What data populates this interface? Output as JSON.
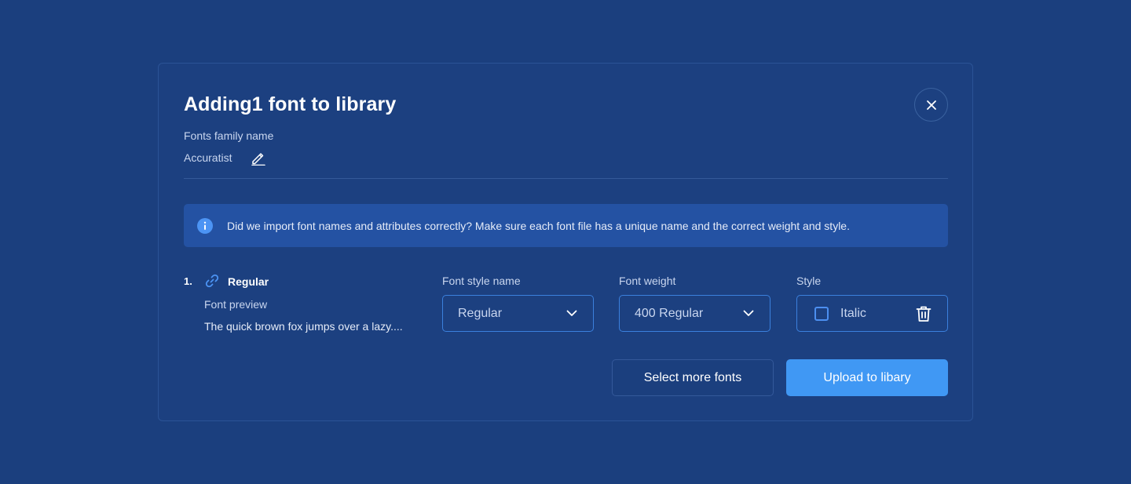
{
  "modal": {
    "title": "Adding1 font to library",
    "family_label": "Fonts family name",
    "family_value": "Accuratist"
  },
  "info": {
    "text": "Did we import font names and attributes correctly? Make sure each font file has a unique name and the correct weight and style."
  },
  "font_row": {
    "index": "1.",
    "name": "Regular",
    "preview_label": "Font preview",
    "preview_text": "The quick brown fox jumps over a lazy....",
    "style_name_label": "Font style name",
    "style_name_value": "Regular",
    "weight_label": "Font weight",
    "weight_value": "400 Regular",
    "style_label": "Style",
    "italic_label": "Italic",
    "italic_checked": false
  },
  "buttons": {
    "select_more": "Select more fonts",
    "upload": "Upload to libary"
  },
  "icons": {
    "close": "close-icon",
    "edit": "pencil-icon",
    "info": "info-icon",
    "link": "link-icon",
    "chevron": "chevron-down-icon",
    "trash": "trash-icon"
  },
  "colors": {
    "background": "#1b3f7e",
    "accent": "#4098f4",
    "info_banner": "#2452a3"
  }
}
